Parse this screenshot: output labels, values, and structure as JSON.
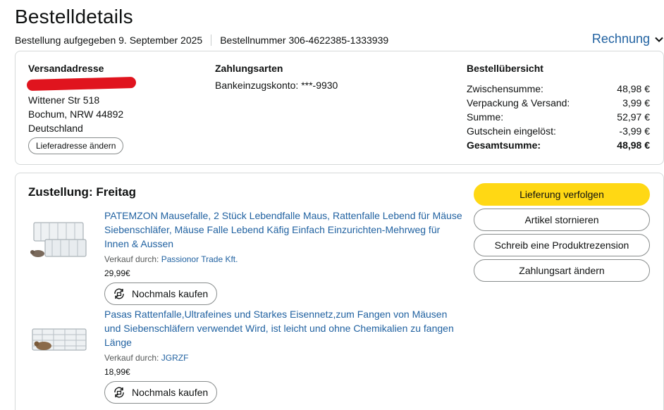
{
  "header": {
    "title": "Bestelldetails",
    "order_date_text": "Bestellung aufgegeben 9. September 2025",
    "order_number_text": "Bestellnummer 306-4622385-1333939",
    "invoice_label": "Rechnung",
    "link_color": "#2162a1"
  },
  "shipping": {
    "title": "Versandadresse",
    "address_lines": [
      "Wittener Str 518",
      "Bochum, NRW 44892",
      "Deutschland"
    ],
    "change_button": "Lieferadresse ändern"
  },
  "payment": {
    "title": "Zahlungsarten",
    "method": "Bankeinzugskonto: ***-9930"
  },
  "summary": {
    "title": "Bestellübersicht",
    "rows": [
      {
        "label": "Zwischensumme:",
        "value": "48,98 €"
      },
      {
        "label": "Verpackung & Versand:",
        "value": "3,99 €"
      },
      {
        "label": "Summe:",
        "value": "52,97 €"
      },
      {
        "label": "Gutschein eingelöst:",
        "value": "-3,99 €"
      },
      {
        "label": "Gesamtsumme:",
        "value": "48,98 €"
      }
    ]
  },
  "delivery": {
    "title": "Zustellung: Freitag",
    "items": [
      {
        "title": "PATEMZON Mausefalle, 2 Stück Lebendfalle Maus, Rattenfalle Lebend für Mäuse Siebenschläfer, Mäuse Falle Lebend Käfig Einfach Einzurichten-Mehrweg für Innen & Aussen",
        "seller_prefix": "Verkauf durch:",
        "seller": "Passionor Trade Kft.",
        "price": "29,99€",
        "buy_again": "Nochmals kaufen"
      },
      {
        "title": "Pasas Rattenfalle,Ultrafeines und Starkes Eisennetz,zum Fangen von Mäusen und Siebenschläfern verwendet Wird, ist leicht und ohne Chemikalien zu fangen Länge",
        "seller_prefix": "Verkauf durch:",
        "seller": "JGRZF",
        "price": "18,99€",
        "buy_again": "Nochmals kaufen"
      }
    ],
    "actions": {
      "track": "Lieferung verfolgen",
      "cancel": "Artikel stornieren",
      "review": "Schreib eine Produktrezension",
      "change_payment": "Zahlungsart ändern"
    },
    "primary_color": "#ffd814"
  }
}
